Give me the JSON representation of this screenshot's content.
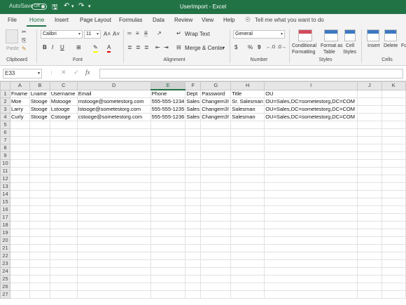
{
  "window": {
    "title": "UserImport  -  Excel",
    "autosave_label": "AutoSave",
    "autosave_state": "Off"
  },
  "tabs": [
    "File",
    "Home",
    "Insert",
    "Page Layout",
    "Formulas",
    "Data",
    "Review",
    "View",
    "Help"
  ],
  "active_tab": "Home",
  "tell_me": "Tell me what you want to do",
  "ribbon": {
    "clipboard": {
      "paste": "Paste",
      "label": "Clipboard"
    },
    "font": {
      "name": "Calibri",
      "size": "11",
      "label": "Font",
      "bold": "B",
      "italic": "I",
      "underline": "U",
      "grow": "A˄",
      "shrink": "A˅",
      "highlight": "✎",
      "color": "A"
    },
    "alignment": {
      "wrap": "Wrap Text",
      "merge": "Merge & Center",
      "label": "Alignment"
    },
    "number": {
      "format": "General",
      "label": "Number",
      "currency": "$",
      "percent": "%",
      "comma": "9"
    },
    "styles": {
      "conditional": [
        "Conditional",
        "Formatting"
      ],
      "table": [
        "Format as",
        "Table"
      ],
      "cell": [
        "Cell",
        "Styles"
      ],
      "label": "Styles"
    },
    "cells": {
      "insert": "Insert",
      "delete": "Delete",
      "format": "Fo",
      "label": "Cells"
    }
  },
  "formula_bar": {
    "name_box": "E33",
    "value": ""
  },
  "columns": [
    "A",
    "B",
    "C",
    "D",
    "E",
    "F",
    "G",
    "H",
    "I",
    "J",
    "K"
  ],
  "selected_column": "E",
  "rows": [
    [
      "Fname",
      "Lname",
      "Username",
      "Email",
      "Phone",
      "Dept",
      "Password",
      "Title",
      "OU",
      "",
      ""
    ],
    [
      "Moe",
      "Stooge",
      "Mstooge",
      "mstooge@sometestorg.com",
      "555-555-1234",
      "Sales",
      "Changem3!",
      "Sr. Salesman",
      "OU=Sales,DC=sometestorg,DC=COM",
      "",
      ""
    ],
    [
      "Larry",
      "Stooge",
      "Lstooge",
      "lstooge@sometestorg.com",
      "555-555-1235",
      "Sales",
      "Changem3!",
      "Salesman",
      "OU=Sales,DC=sometestorg,DC=COM",
      "",
      ""
    ],
    [
      "Curly",
      "Stooge",
      "Cstooge",
      "cstooge@sometestorg.com",
      "555-555-1236",
      "Sales",
      "Changem3!",
      "Salesman",
      "OU=Sales,DC=sometestorg,DC=COM",
      "",
      ""
    ]
  ],
  "row_count": 27,
  "colors": {
    "brand": "#217346",
    "header": "#e6e6e6",
    "gridline": "#e1e1e1"
  }
}
